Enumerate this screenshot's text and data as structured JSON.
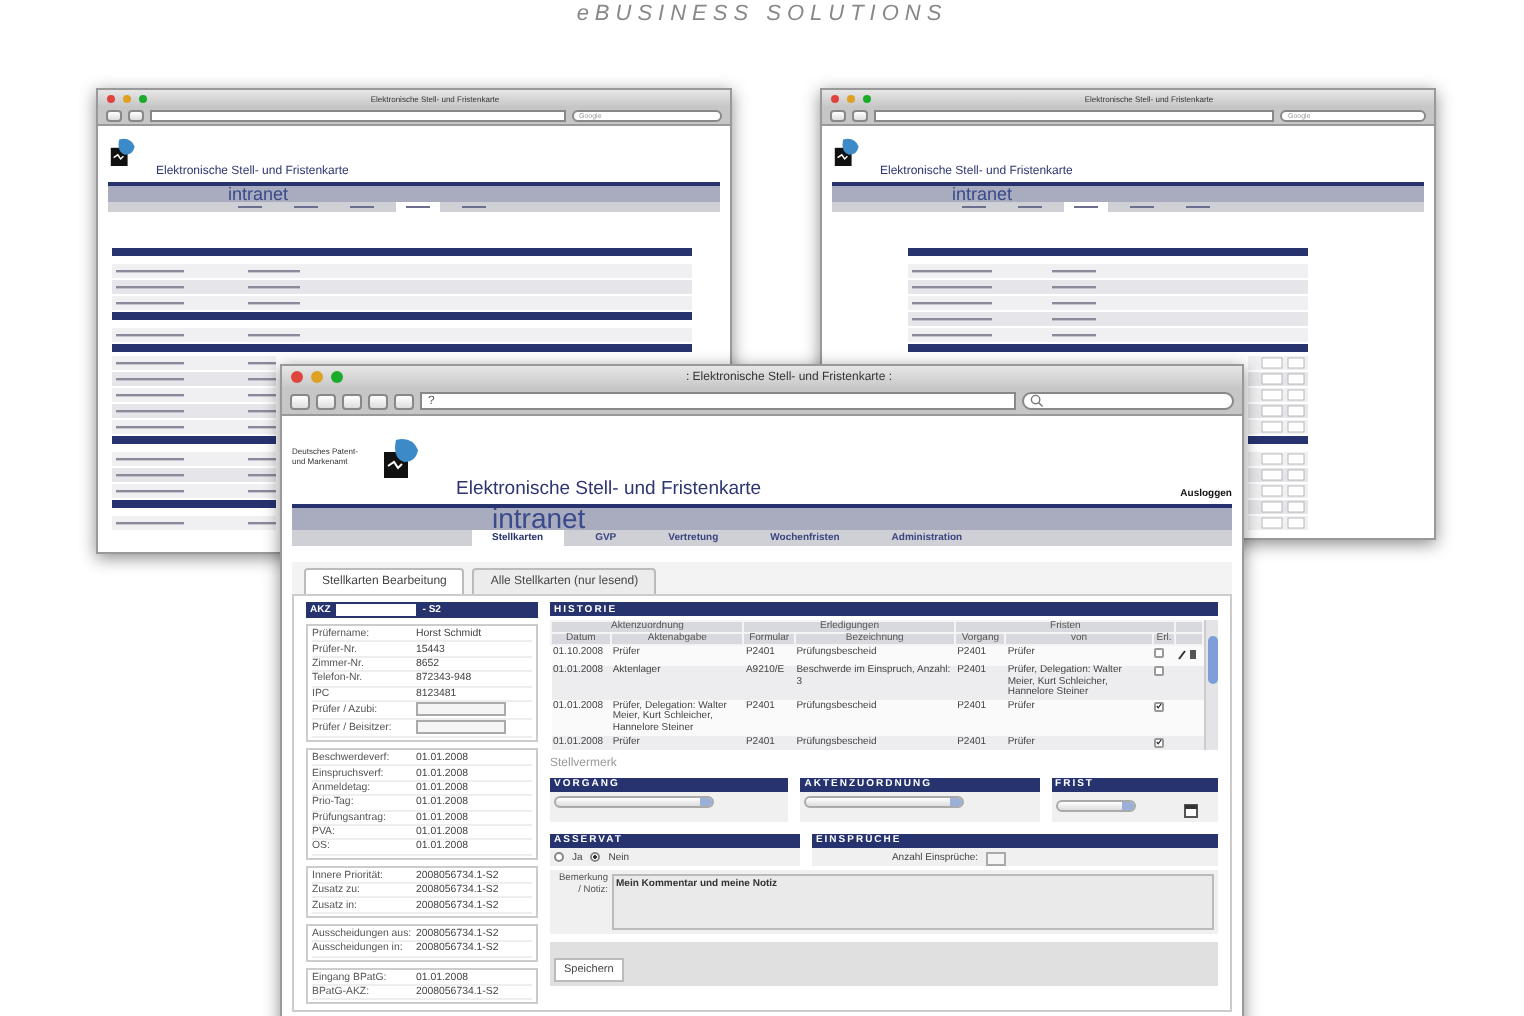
{
  "tagline": "eBUSINESS SOLUTIONS",
  "back_windows": [
    {
      "window_title": "Elektronische Stell- und Fristenkarte",
      "search_placeholder": "Google",
      "app_title": "Elektronische Stell- und Fristenkarte",
      "brand": "intranet",
      "nav": [
        {
          "selected": false
        },
        {
          "selected": false
        },
        {
          "selected": false
        },
        {
          "selected": true
        },
        {
          "selected": false
        }
      ]
    },
    {
      "window_title": "Elektronische Stell- und Fristenkarte",
      "search_placeholder": "Google",
      "app_title": "Elektronische Stell- und Fristenkarte",
      "brand": "intranet",
      "nav": [
        {
          "selected": false
        },
        {
          "selected": false
        },
        {
          "selected": true
        },
        {
          "selected": false
        },
        {
          "selected": false
        }
      ]
    }
  ],
  "window": {
    "title": ": Elektronische Stell- und Fristenkarte :",
    "url": "?"
  },
  "header": {
    "org": "Deutsches Patent- und Markenamt",
    "app_title": "Elektronische Stell- und Fristenkarte",
    "logout": "Ausloggen",
    "brand": "intranet"
  },
  "nav": [
    {
      "label": "Stellkarten",
      "selected": true
    },
    {
      "label": "GVP",
      "selected": false
    },
    {
      "label": "Vertretung",
      "selected": false
    },
    {
      "label": "Wochenfristen",
      "selected": false
    },
    {
      "label": "Administration",
      "selected": false
    }
  ],
  "tabs": [
    {
      "label": "Stellkarten Bearbeitung",
      "selected": true
    },
    {
      "label": "Alle Stellkarten (nur lesend)",
      "selected": false
    }
  ],
  "akz": {
    "label": "AKZ",
    "suffix": "- S2"
  },
  "info_groups": [
    [
      {
        "label": "Prüfername:",
        "value": "Horst Schmidt",
        "kind": "text"
      },
      {
        "label": "Prüfer-Nr.",
        "value": "15443",
        "kind": "text"
      },
      {
        "label": "Zimmer-Nr.",
        "value": "8652",
        "kind": "text"
      },
      {
        "label": "Telefon-Nr.",
        "value": "872343-948",
        "kind": "text"
      },
      {
        "label": "IPC",
        "value": "8123481",
        "kind": "text"
      },
      {
        "label": "Prüfer / Azubi:",
        "kind": "input"
      },
      {
        "label": "Prüfer / Beisitzer:",
        "kind": "input"
      }
    ],
    [
      {
        "label": "Beschwerdeverf:",
        "value": "01.01.2008",
        "kind": "text"
      },
      {
        "label": "Einspruchsverf:",
        "value": "01.01.2008",
        "kind": "text"
      },
      {
        "label": "Anmeldetag:",
        "value": "01.01.2008",
        "kind": "text"
      },
      {
        "label": "Prio-Tag:",
        "value": "01.01.2008",
        "kind": "text"
      },
      {
        "label": "Prüfungsantrag:",
        "value": "01.01.2008",
        "kind": "text"
      },
      {
        "label": "PVA:",
        "value": "01.01.2008",
        "kind": "text"
      },
      {
        "label": "OS:",
        "value": "01.01.2008",
        "kind": "text"
      }
    ],
    [
      {
        "label": "Innere Priorität:",
        "value": "2008056734.1-S2",
        "kind": "text"
      },
      {
        "label": "Zusatz zu:",
        "value": "2008056734.1-S2",
        "kind": "text"
      },
      {
        "label": "Zusatz in:",
        "value": "2008056734.1-S2",
        "kind": "text"
      }
    ],
    [
      {
        "label": "Ausscheidungen aus:",
        "value": "2008056734.1-S2",
        "kind": "text"
      },
      {
        "label": "Ausscheidungen in:",
        "value": "2008056734.1-S2",
        "kind": "text"
      }
    ],
    [
      {
        "label": "Eingang BPatG:",
        "value": "01.01.2008",
        "kind": "text"
      },
      {
        "label": "BPatG-AKZ:",
        "value": "2008056734.1-S2",
        "kind": "text"
      }
    ]
  ],
  "history": {
    "title": "HISTORIE",
    "groups": [
      {
        "label": "Aktenzuordnung"
      },
      {
        "label": "Erledigungen"
      },
      {
        "label": "Fristen"
      }
    ],
    "columns": [
      "Datum",
      "Aktenabgabe",
      "Formular",
      "Bezeichnung",
      "Vorgang",
      "von",
      "Erl."
    ],
    "rows": [
      {
        "cells": [
          "01.10.2008",
          "Prüfer",
          "P2401",
          "Prüfungsbescheid",
          "P2401",
          "Prüfer"
        ],
        "checked": false
      },
      {
        "cells": [
          "01.01.2008",
          "Aktenlager",
          "A9210/E",
          "Beschwerde im Einspruch, Anzahl: 3",
          "P2401",
          "Prüfer, Delegation: Walter Meier, Kurt Schleicher, Hannelore Steiner"
        ],
        "checked": false
      },
      {
        "cells": [
          "01.01.2008",
          "Prüfer, Delegation: Walter Meier, Kurt Schleicher, Hannelore Steiner",
          "P2401",
          "Prüfungsbescheid",
          "P2401",
          "Prüfer"
        ],
        "checked": true
      },
      {
        "cells": [
          "01.01.2008",
          "Prüfer",
          "P2401",
          "Prüfungsbescheid",
          "P2401",
          "Prüfer"
        ],
        "checked": true
      }
    ]
  },
  "stellvermerk": "Stellvermerk",
  "select_panels": [
    {
      "title": "VORGANG",
      "kind": "select"
    },
    {
      "title": "AKTENZUORDNUNG",
      "kind": "select"
    },
    {
      "title": "FRIST",
      "kind": "date"
    }
  ],
  "asservat": {
    "title": "ASSERVAT",
    "options": [
      {
        "label": "Ja",
        "selected": false
      },
      {
        "label": "Nein",
        "selected": true
      }
    ]
  },
  "einsprueche": {
    "title": "EINSPRÜCHE",
    "label": "Anzahl Einsprüche:"
  },
  "note": {
    "label": "Bemerkung / Notiz:",
    "value": "Mein Kommentar und meine Notiz"
  },
  "save": "Speichern"
}
